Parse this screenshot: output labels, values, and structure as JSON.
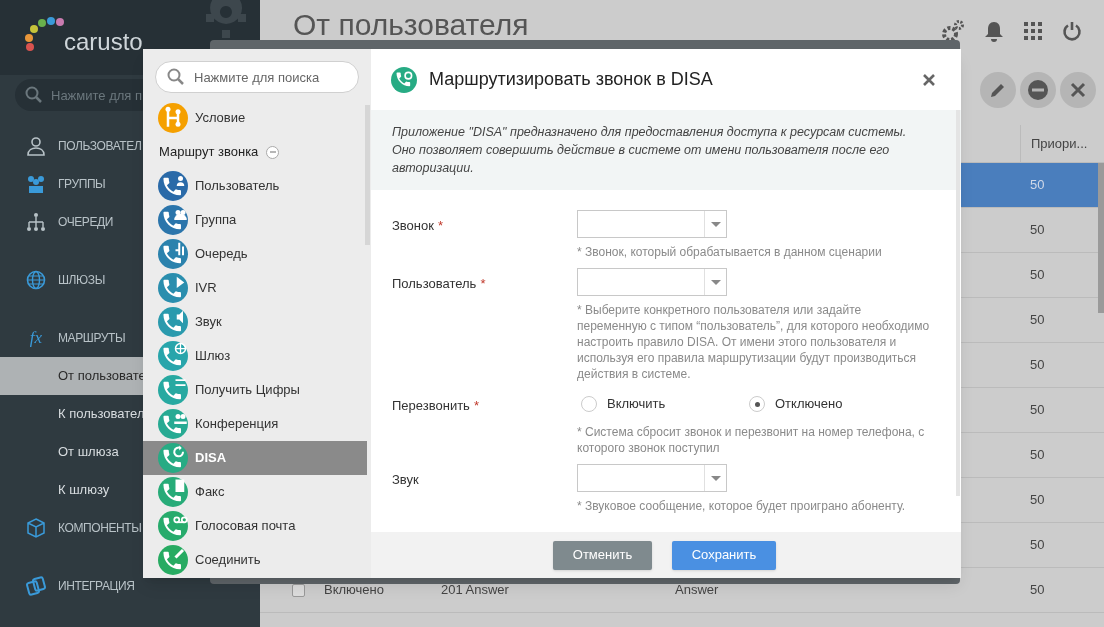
{
  "sidebar": {
    "logo": "carusto",
    "search": {
      "placeholder": "Нажмите для п"
    },
    "items": [
      {
        "kind": "section",
        "label": "ПОЛЬЗОВАТЕЛ",
        "selected": false
      },
      {
        "kind": "section",
        "label": "ГРУППЫ",
        "selected": false
      },
      {
        "kind": "section",
        "label": "ОЧЕРЕДИ",
        "selected": false
      },
      {
        "kind": "section",
        "label": "ШЛЮЗЫ",
        "selected": false
      },
      {
        "kind": "section",
        "label": "МАРШРУТЫ",
        "selected": false,
        "glyph": "fx"
      },
      {
        "kind": "sub",
        "label": "От пользовате",
        "selected": true
      },
      {
        "kind": "sub",
        "label": "К пользовател",
        "selected": false
      },
      {
        "kind": "sub",
        "label": "От шлюза",
        "selected": false
      },
      {
        "kind": "sub",
        "label": "К шлюзу",
        "selected": false
      },
      {
        "kind": "section",
        "label": "КОМПОНЕНТЫ",
        "selected": false
      },
      {
        "kind": "section",
        "label": "ИНТЕГРАЦИЯ",
        "selected": false
      }
    ]
  },
  "page": {
    "title": "От пользователя",
    "table": {
      "columns": [
        "Приори..."
      ],
      "rows": [
        {
          "selected": true,
          "priority": "50"
        },
        {
          "selected": false,
          "priority": "50"
        },
        {
          "selected": false,
          "priority": "50"
        },
        {
          "selected": false,
          "priority": "50"
        },
        {
          "selected": false,
          "priority": "50"
        },
        {
          "selected": false,
          "priority": "50"
        },
        {
          "selected": false,
          "priority": "50"
        },
        {
          "selected": false,
          "priority": "50"
        },
        {
          "selected": false,
          "priority": "50"
        },
        {
          "selected": false,
          "checked": false,
          "status": "Включено",
          "name": "201 Answer",
          "app": "Answer",
          "priority": "50"
        }
      ]
    }
  },
  "dialog": {
    "title": "Маршрутизировать звонок в DISA",
    "palette": {
      "search": {
        "placeholder": "Нажмите для поиска"
      },
      "items": [
        {
          "kind": "item",
          "label": "Условие",
          "color": "#f5a000",
          "selected": false
        },
        {
          "kind": "group",
          "label": "Маршрут звонка",
          "expanded": true
        },
        {
          "kind": "item",
          "label": "Пользователь",
          "color": "#2a6aa8",
          "selected": false
        },
        {
          "kind": "item",
          "label": "Группа",
          "color": "#2b75ab",
          "selected": false
        },
        {
          "kind": "item",
          "label": "Очередь",
          "color": "#2b82ad",
          "selected": false
        },
        {
          "kind": "item",
          "label": "IVR",
          "color": "#2a8eae",
          "selected": false
        },
        {
          "kind": "item",
          "label": "Звук",
          "color": "#2a9aad",
          "selected": false
        },
        {
          "kind": "item",
          "label": "Шлюз",
          "color": "#28a5ab",
          "selected": false
        },
        {
          "kind": "item",
          "label": "Получить Цифры",
          "color": "#27a9a1",
          "selected": false
        },
        {
          "kind": "item",
          "label": "Конференция",
          "color": "#27aa93",
          "selected": false
        },
        {
          "kind": "item",
          "label": "DISA",
          "color": "#27ab84",
          "selected": true
        },
        {
          "kind": "item",
          "label": "Факс",
          "color": "#27ab78",
          "selected": false
        },
        {
          "kind": "item",
          "label": "Голосовая почта",
          "color": "#27ab6c",
          "selected": false
        },
        {
          "kind": "item",
          "label": "Соединить",
          "color": "#27ab62",
          "selected": false
        }
      ]
    },
    "description": "Приложение \"DISA\" предназначено для предоставления доступа к ресурсам системы. Оно позволяет совершить действие в системе от имени пользователя после его авторизации.",
    "fields": [
      {
        "kind": "select",
        "label": "Звонок",
        "required_mark": "*",
        "hint": "* Звонок, который обрабатывается в данном сценарии"
      },
      {
        "kind": "select",
        "label": "Пользователь",
        "required_mark": "*",
        "hint": "* Выберите конкретного пользователя или задайте переменную с типом “пользователь”, для которого необходимо настроить правило DISA. От имени этого пользователя и используя его правила маршрутизации будут производиться действия в системе."
      },
      {
        "kind": "radio",
        "label": "Перезвонить",
        "required_mark": "*",
        "options": [
          {
            "label": "Включить",
            "selected": false
          },
          {
            "label": "Отключено",
            "selected": true
          }
        ],
        "hint": "* Система сбросит звонок и перезвонит на номер телефона, с которого звонок поступил"
      },
      {
        "kind": "select",
        "label": "Звук",
        "hint": "* Звуковое сообщение, которое будет проиграно абоненту."
      }
    ],
    "buttons": [
      {
        "kind": "cancel",
        "label": "Отменить"
      },
      {
        "kind": "save",
        "label": "Сохранить"
      }
    ]
  }
}
